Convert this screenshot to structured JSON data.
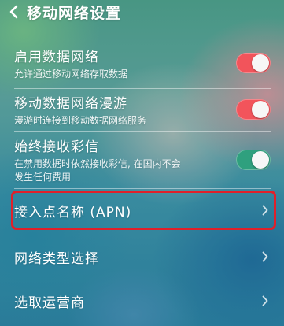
{
  "header": {
    "title": "移动网络设置"
  },
  "settings": {
    "enable_data": {
      "title": "启用数据网络",
      "subtitle": "允许通过移动网络存取数据",
      "state": "on",
      "color": "#f2545b"
    },
    "roaming": {
      "title": "移动数据网络漫游",
      "subtitle": "漫游时连接到移动数据网络服务",
      "state": "on",
      "color": "#f2545b"
    },
    "mms": {
      "title": "始终接收彩信",
      "subtitle_line1": "在禁用数据时依然接收彩信, 在国内不会",
      "subtitle_line2": "发生任何费用",
      "state": "on",
      "color": "#2fa07e"
    },
    "apn": {
      "title": "接入点名称 (APN)"
    },
    "network_type": {
      "title": "网络类型选择"
    },
    "operator": {
      "title": "选取运营商"
    }
  },
  "highlight_color": "#e0202a"
}
